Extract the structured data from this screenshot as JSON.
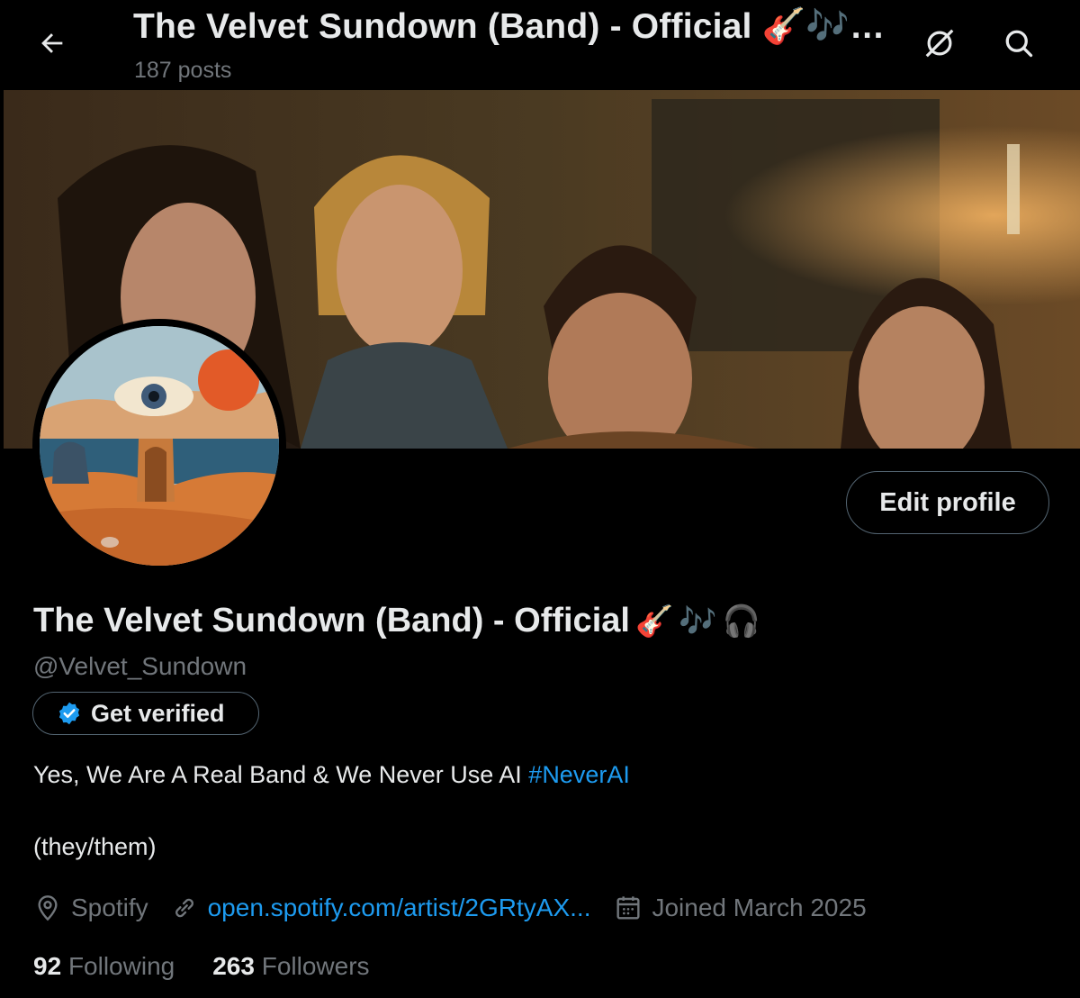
{
  "header": {
    "title": "The Velvet Sundown (Band) - Official 🎸🎶…",
    "posts_count": "187 posts"
  },
  "profile": {
    "display_name": "The Velvet Sundown (Band) - Official",
    "name_emojis": [
      "🎸",
      "🎶",
      "🎧"
    ],
    "handle": "@Velvet_Sundown",
    "edit_profile_label": "Edit profile",
    "get_verified_label": "Get verified",
    "bio_text": "Yes, We Are A Real Band & We Never Use AI ",
    "bio_hashtag": "#NeverAI",
    "pronouns": "(they/them)",
    "location": "Spotify",
    "website": "open.spotify.com/artist/2GRtyAX...",
    "joined": "Joined March 2025",
    "following_count": "92",
    "following_label": "Following",
    "followers_count": "263",
    "followers_label": "Followers"
  },
  "icons": [
    "back-arrow-icon",
    "no-grok-icon",
    "search-icon",
    "verified-badge-icon",
    "location-pin-icon",
    "link-icon",
    "calendar-icon"
  ],
  "colors": {
    "background": "#000000",
    "text_primary": "#e7e9ea",
    "text_secondary": "#71767b",
    "accent": "#1d9bf0",
    "border": "#536471"
  }
}
